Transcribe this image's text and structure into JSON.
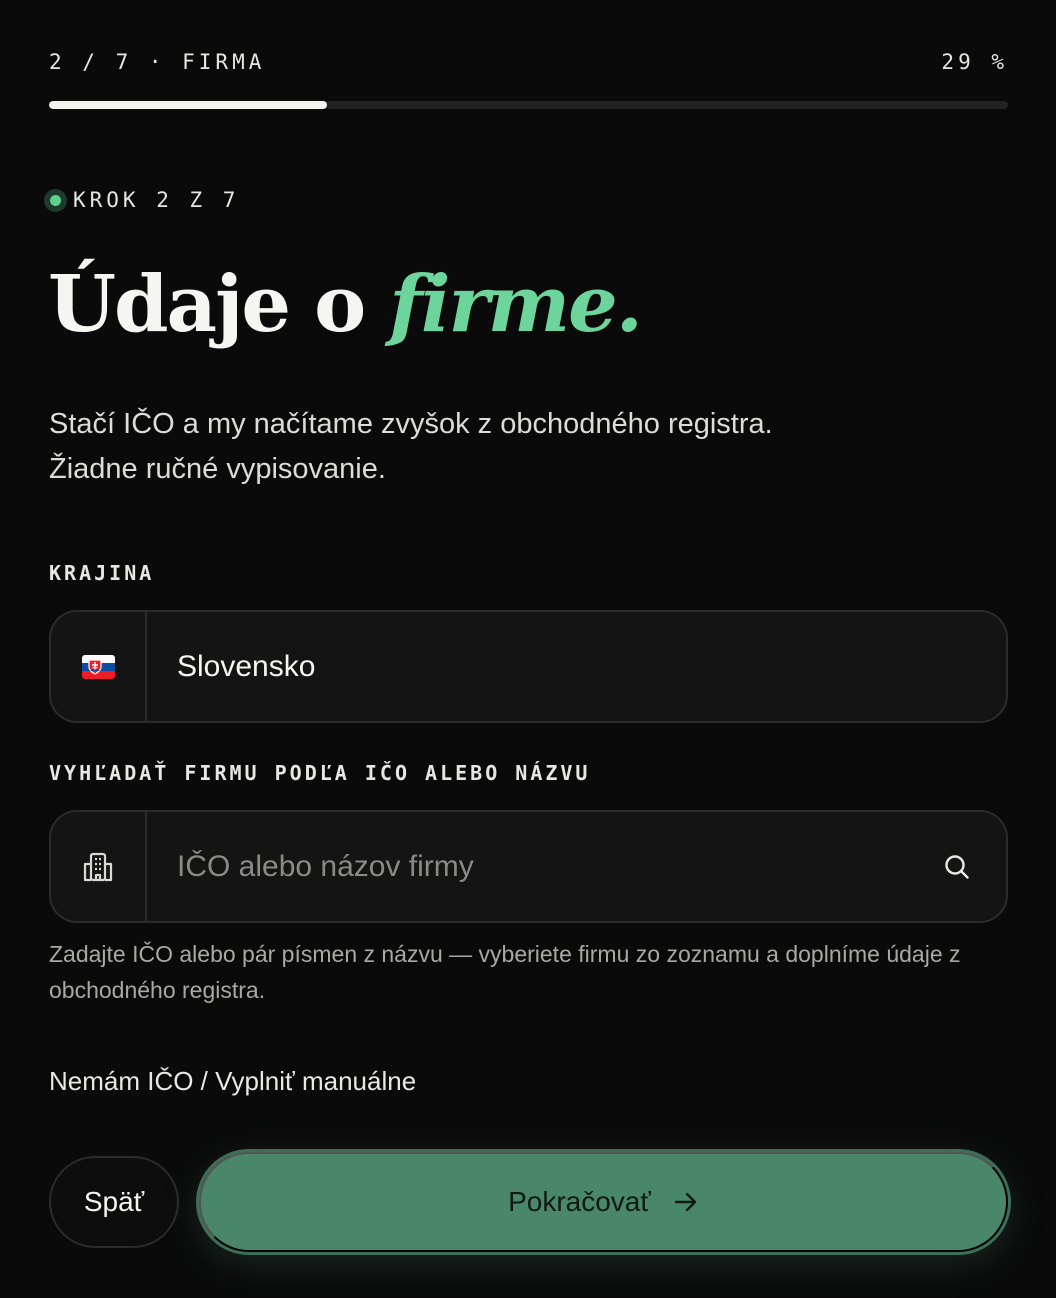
{
  "progress": {
    "step_label": "2 / 7 · FIRMA",
    "percent_label": "29 %",
    "fraction": 0.29
  },
  "step_indicator": {
    "label": "KROK 2 Z 7"
  },
  "heading": {
    "main": "Údaje o ",
    "accent": "firme."
  },
  "lead": {
    "line1": "Stačí IČO a my načítame zvyšok z obchodného registra.",
    "line2": "Žiadne ručné vypisovanie."
  },
  "country": {
    "label": "KRAJINA",
    "value": "Slovensko",
    "flag_icon": "slovakia-flag-icon"
  },
  "company_search": {
    "label": "VYHĽADAŤ FIRMU PODĽA IČO ALEBO NÁZVU",
    "placeholder": "IČO alebo názov firmy",
    "value": "",
    "lead_icon": "building-icon",
    "action_icon": "search-icon",
    "hint": "Zadajte IČO alebo pár písmen z názvu — vyberiete firmu zo zoznamu a doplníme údaje z obchodného registra."
  },
  "manual_link": "Nemám IČO / Vyplniť manuálne",
  "buttons": {
    "back": "Späť",
    "continue": "Pokračovať",
    "continue_icon": "arrow-right-icon"
  },
  "colors": {
    "background": "#0a0a0a",
    "accent": "#6dd59b",
    "primary_button": "#4a876a"
  }
}
